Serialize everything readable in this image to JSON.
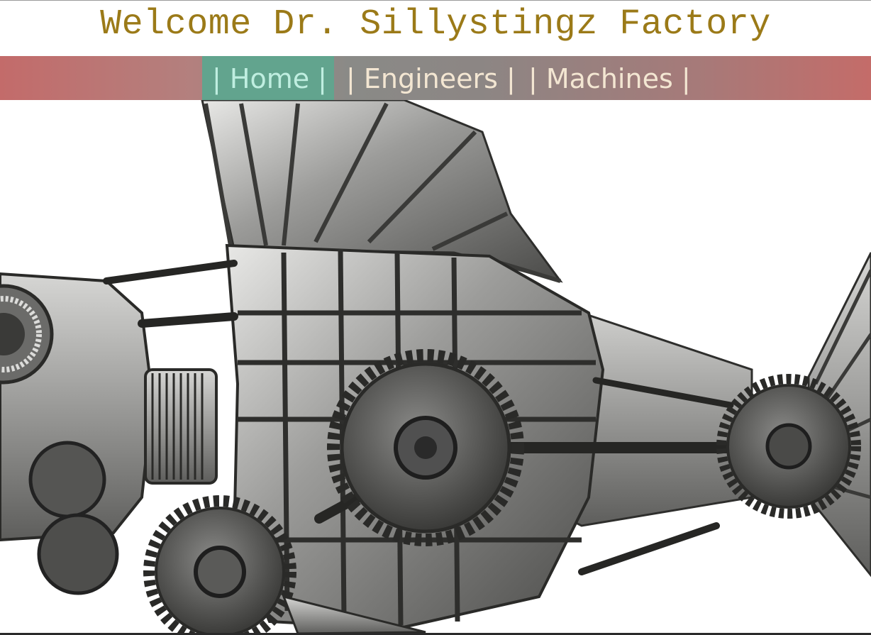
{
  "header": {
    "title": "Welcome Dr. Sillystingz Factory"
  },
  "nav": {
    "items": [
      {
        "label": "| Home |",
        "active": true
      },
      {
        "label": "| Engineers |",
        "active": false
      },
      {
        "label": "| Machines |",
        "active": false
      }
    ]
  },
  "hero": {
    "image_subject": "mechanical-fish-illustration"
  },
  "colors": {
    "title": "#9b7a18",
    "nav_active_bg": "#62a48e",
    "nav_text": "#f3e6d2",
    "nav_gradient_edge": "#c36b6a"
  }
}
